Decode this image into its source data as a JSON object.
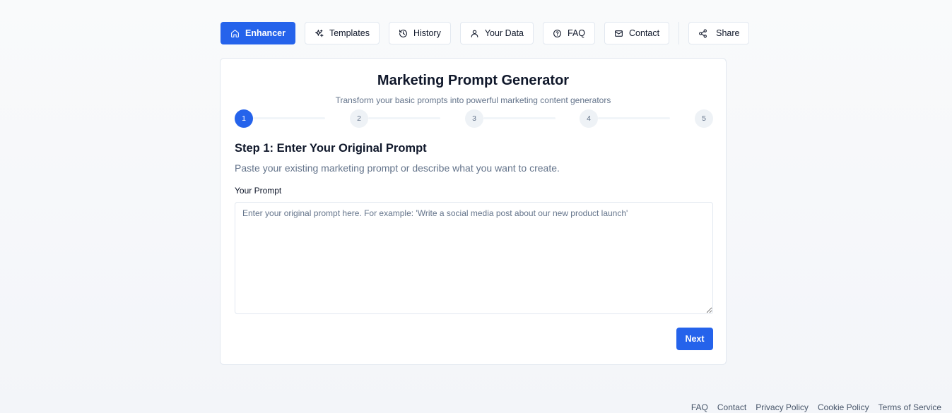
{
  "nav": {
    "items": [
      {
        "label": "Enhancer",
        "icon": "home-icon",
        "active": true
      },
      {
        "label": "Templates",
        "icon": "sparkles-icon",
        "active": false
      },
      {
        "label": "History",
        "icon": "history-icon",
        "active": false
      },
      {
        "label": "Your Data",
        "icon": "user-icon",
        "active": false
      },
      {
        "label": "FAQ",
        "icon": "help-circle-icon",
        "active": false
      },
      {
        "label": "Contact",
        "icon": "mail-icon",
        "active": false
      }
    ],
    "share": {
      "label": "Share",
      "icon": "share-icon"
    }
  },
  "card": {
    "title": "Marketing Prompt Generator",
    "subtitle": "Transform your basic prompts into powerful marketing content generators",
    "steps": [
      "1",
      "2",
      "3",
      "4",
      "5"
    ],
    "current_step": 1,
    "step_heading": "Step 1: Enter Your Original Prompt",
    "step_description": "Paste your existing marketing prompt or describe what you want to create.",
    "field_label": "Your Prompt",
    "field_value": "",
    "field_placeholder": "Enter your original prompt here. For example: 'Write a social media post about our new product launch'",
    "next_label": "Next"
  },
  "footer": {
    "links": [
      "FAQ",
      "Contact",
      "Privacy Policy",
      "Cookie Policy",
      "Terms of Service"
    ]
  },
  "colors": {
    "accent": "#2563eb",
    "muted_text": "#64748b",
    "border": "#e2e8f0"
  }
}
